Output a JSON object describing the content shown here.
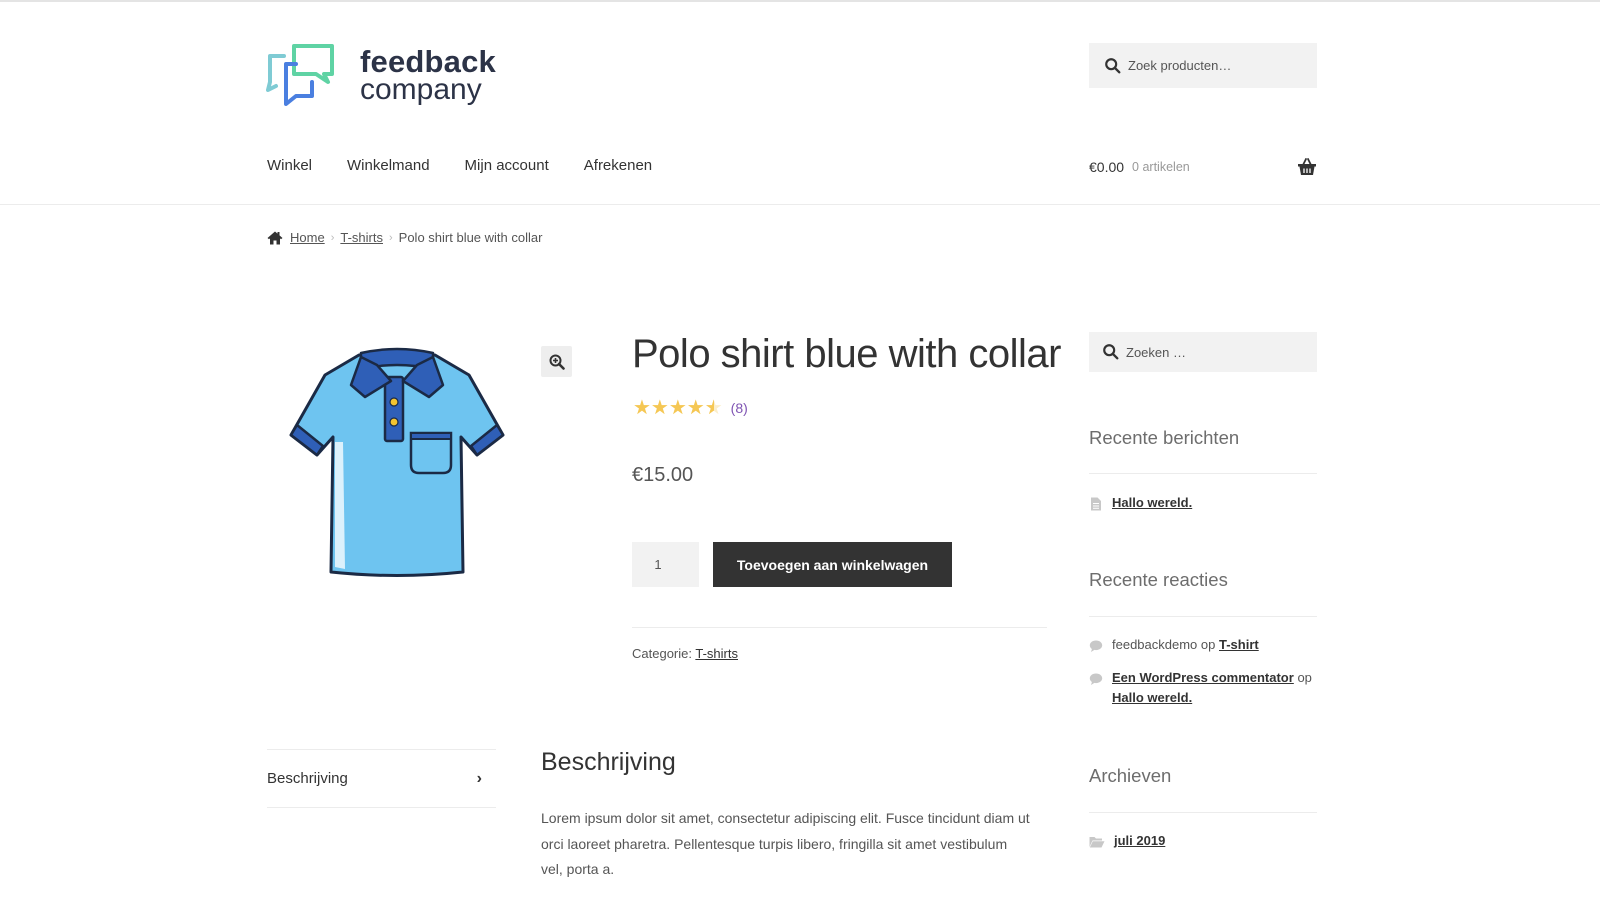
{
  "header": {
    "logo": {
      "line1": "feedback",
      "line2": "company"
    },
    "search": {
      "placeholder": "Zoek producten…",
      "icon": "search-icon"
    },
    "nav": [
      {
        "label": "Winkel"
      },
      {
        "label": "Winkelmand"
      },
      {
        "label": "Mijn account"
      },
      {
        "label": "Afrekenen"
      }
    ],
    "cart": {
      "amount": "€0.00",
      "count": "0 artikelen",
      "icon": "basket-icon"
    }
  },
  "breadcrumb": {
    "items": [
      {
        "label": "Home",
        "link": true
      },
      {
        "label": "T-shirts",
        "link": true
      },
      {
        "label": "Polo shirt blue with collar",
        "link": false
      }
    ]
  },
  "product": {
    "title": "Polo shirt blue with collar",
    "rating": 4.5,
    "rating_max": 5,
    "stars_glyph": "★★★★★",
    "review_count": "(8)",
    "price": "€15.00",
    "quantity": "1",
    "add_to_cart_label": "Toevoegen aan winkelwagen",
    "category_label": "Categorie:",
    "category": "T-shirts",
    "image_alt": "Polo shirt blue with collar"
  },
  "tabs": {
    "items": [
      {
        "label": "Beschrijving",
        "chevron": "›"
      }
    ]
  },
  "description": {
    "title": "Beschrijving",
    "text": "Lorem ipsum dolor sit amet, consectetur adipiscing elit. Fusce tincidunt diam ut orci laoreet pharetra. Pellentesque turpis libero, fringilla sit amet vestibulum vel, porta a."
  },
  "sidebar": {
    "search": {
      "placeholder": "Zoeken …"
    },
    "recent_posts": {
      "title": "Recente berichten",
      "items": [
        {
          "label": "Hallo wereld."
        }
      ]
    },
    "recent_comments": {
      "title": "Recente reacties",
      "items": [
        {
          "author": "feedbackdemo",
          "connector": "op",
          "post": "T-shirt"
        },
        {
          "author": "Een WordPress commentator",
          "connector": "op",
          "post": "Hallo wereld."
        }
      ]
    },
    "archives": {
      "title": "Archieven",
      "items": [
        {
          "label": "juli 2019"
        }
      ]
    }
  },
  "colors": {
    "accent_button": "#333333",
    "star": "#f5c754",
    "review_link": "#7f54b3",
    "logo_text": "#2c3347",
    "logo_green": "#5fd3a4",
    "logo_blue": "#4a7fe0",
    "logo_teal": "#7fcbd4"
  }
}
